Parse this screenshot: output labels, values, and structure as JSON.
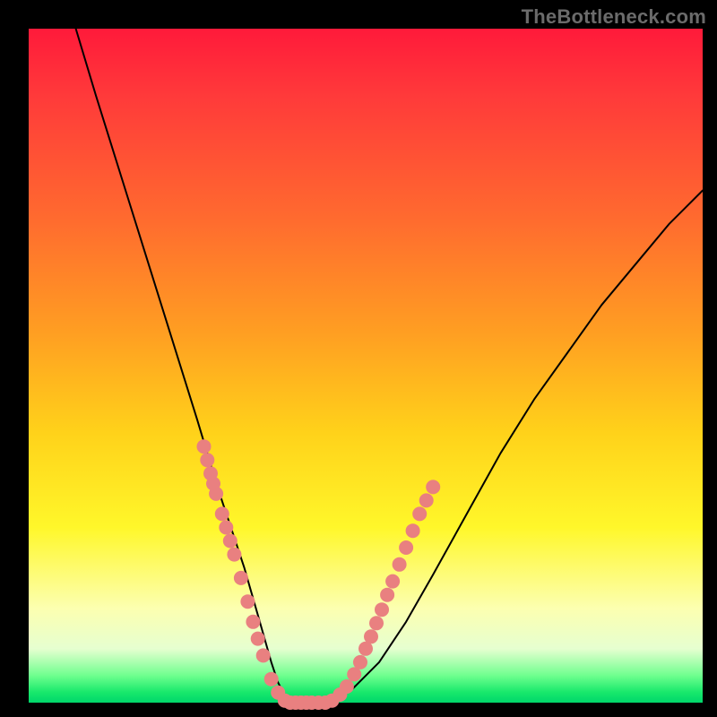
{
  "watermark": "TheBottleneck.com",
  "colors": {
    "background": "#000000",
    "curve_stroke": "#000000",
    "marker_fill": "#e98080",
    "gradient_top": "#ff1a3a",
    "gradient_bottom": "#00d66b"
  },
  "chart_data": {
    "type": "line",
    "title": "",
    "xlabel": "",
    "ylabel": "",
    "xlim": [
      0,
      100
    ],
    "ylim": [
      0,
      100
    ],
    "grid": false,
    "series": [
      {
        "name": "bottleneck-curve",
        "x": [
          7,
          10,
          15,
          20,
          25,
          28,
          30,
          32,
          34,
          36,
          37,
          38,
          39,
          40,
          44,
          48,
          52,
          56,
          60,
          65,
          70,
          75,
          80,
          85,
          90,
          95,
          100
        ],
        "y": [
          100,
          90,
          74,
          58,
          42,
          32,
          26,
          20,
          13,
          6,
          3,
          1,
          0,
          0,
          0,
          2,
          6,
          12,
          19,
          28,
          37,
          45,
          52,
          59,
          65,
          71,
          76
        ]
      }
    ],
    "markers": [
      {
        "x": 26.0,
        "y": 38
      },
      {
        "x": 26.5,
        "y": 36
      },
      {
        "x": 27.0,
        "y": 34
      },
      {
        "x": 27.4,
        "y": 32.5
      },
      {
        "x": 27.8,
        "y": 31
      },
      {
        "x": 28.7,
        "y": 28
      },
      {
        "x": 29.3,
        "y": 26
      },
      {
        "x": 29.9,
        "y": 24
      },
      {
        "x": 30.5,
        "y": 22
      },
      {
        "x": 31.5,
        "y": 18.5
      },
      {
        "x": 32.5,
        "y": 15
      },
      {
        "x": 33.3,
        "y": 12
      },
      {
        "x": 34.0,
        "y": 9.5
      },
      {
        "x": 34.8,
        "y": 7
      },
      {
        "x": 36.0,
        "y": 3.5
      },
      {
        "x": 37.0,
        "y": 1.5
      },
      {
        "x": 38.0,
        "y": 0.3
      },
      {
        "x": 38.8,
        "y": 0
      },
      {
        "x": 39.6,
        "y": 0
      },
      {
        "x": 40.4,
        "y": 0
      },
      {
        "x": 41.2,
        "y": 0
      },
      {
        "x": 42.0,
        "y": 0
      },
      {
        "x": 43.0,
        "y": 0
      },
      {
        "x": 44.0,
        "y": 0
      },
      {
        "x": 45.0,
        "y": 0.3
      },
      {
        "x": 46.2,
        "y": 1.2
      },
      {
        "x": 47.2,
        "y": 2.4
      },
      {
        "x": 48.3,
        "y": 4.2
      },
      {
        "x": 49.2,
        "y": 6
      },
      {
        "x": 50.0,
        "y": 8
      },
      {
        "x": 50.8,
        "y": 9.8
      },
      {
        "x": 51.6,
        "y": 11.8
      },
      {
        "x": 52.4,
        "y": 13.8
      },
      {
        "x": 53.2,
        "y": 16
      },
      {
        "x": 54.0,
        "y": 18
      },
      {
        "x": 55.0,
        "y": 20.5
      },
      {
        "x": 56.0,
        "y": 23
      },
      {
        "x": 57.0,
        "y": 25.5
      },
      {
        "x": 58.0,
        "y": 28
      },
      {
        "x": 59.0,
        "y": 30
      },
      {
        "x": 60.0,
        "y": 32
      }
    ]
  }
}
